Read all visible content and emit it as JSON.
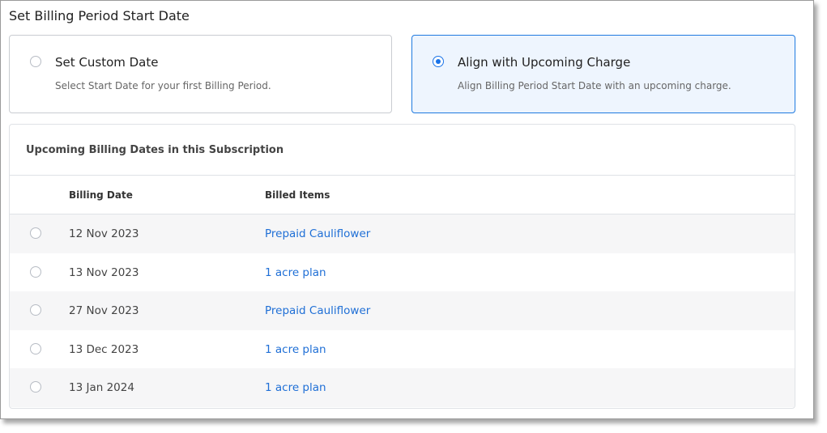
{
  "section": {
    "title": "Set Billing Period Start Date"
  },
  "options": {
    "custom": {
      "title": "Set Custom Date",
      "description": "Select Start Date for your first Billing Period.",
      "selected": false
    },
    "align": {
      "title": "Align with Upcoming Charge",
      "description": "Align Billing Period Start Date with an upcoming charge.",
      "selected": true
    }
  },
  "panel": {
    "title": "Upcoming Billing Dates in this Subscription",
    "columns": {
      "date": "Billing Date",
      "items": "Billed Items"
    },
    "rows": [
      {
        "date": "12 Nov 2023",
        "item": "Prepaid Cauliflower"
      },
      {
        "date": "13 Nov 2023",
        "item": "1 acre plan"
      },
      {
        "date": "27 Nov 2023",
        "item": "Prepaid Cauliflower"
      },
      {
        "date": "13 Dec 2023",
        "item": "1 acre plan"
      },
      {
        "date": "13 Jan 2024",
        "item": "1 acre plan"
      }
    ]
  },
  "colors": {
    "accent": "#1a73e8",
    "link": "#1f6fd6",
    "selected_card_bg": "#eef5fe"
  },
  "icons": {
    "option_radio": "radio-icon",
    "row_radio": "radio-icon"
  }
}
